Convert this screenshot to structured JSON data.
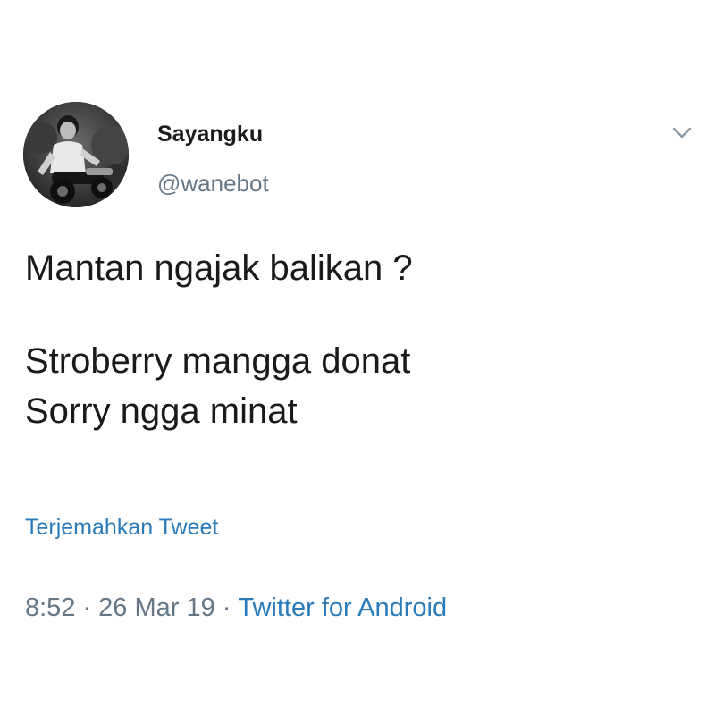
{
  "author": {
    "display_name": "Sayangku",
    "handle": "@wanebot"
  },
  "tweet": {
    "lines": [
      "Mantan ngajak balikan ?",
      "Stroberry mangga donat",
      "Sorry ngga minat"
    ],
    "translate_label": "Terjemahkan Tweet"
  },
  "meta": {
    "time": "8:52",
    "separator": "·",
    "date": "26 Mar 19",
    "source": "Twitter for Android"
  },
  "icons": {
    "more": "chevron-down-icon"
  },
  "colors": {
    "link": "#2b7bb9",
    "secondary_text": "#657786",
    "primary_text": "#14171a",
    "background": "#ffffff"
  }
}
